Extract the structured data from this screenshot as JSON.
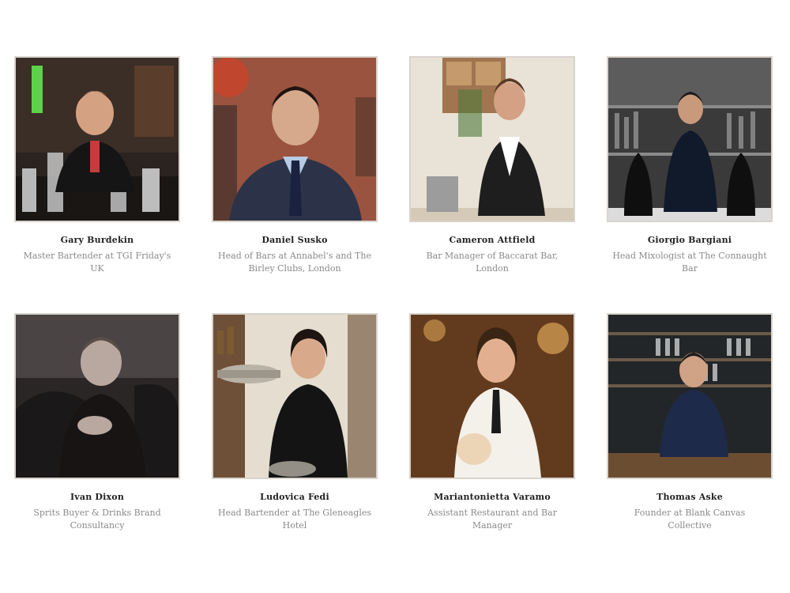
{
  "people": [
    {
      "name": "Gary Burdekin",
      "role": "Master Bartender at TGI Friday's UK"
    },
    {
      "name": "Daniel Susko",
      "role": "Head of Bars at Annabel's and The Birley Clubs, London"
    },
    {
      "name": "Cameron Attfield",
      "role": "Bar Manager of Baccarat Bar, London"
    },
    {
      "name": "Giorgio Bargiani",
      "role": "Head Mixologist at The Connaught Bar"
    },
    {
      "name": "Ivan Dixon",
      "role": "Sprits Buyer & Drinks Brand Consultancy"
    },
    {
      "name": "Ludovica Fedi",
      "role": "Head Bartender at The Gleneagles Hotel"
    },
    {
      "name": "Mariantonietta Varamo",
      "role": "Assistant Restaurant and Bar Manager"
    },
    {
      "name": "Thomas Aske",
      "role": "Founder at Blank Canvas Collective"
    }
  ]
}
